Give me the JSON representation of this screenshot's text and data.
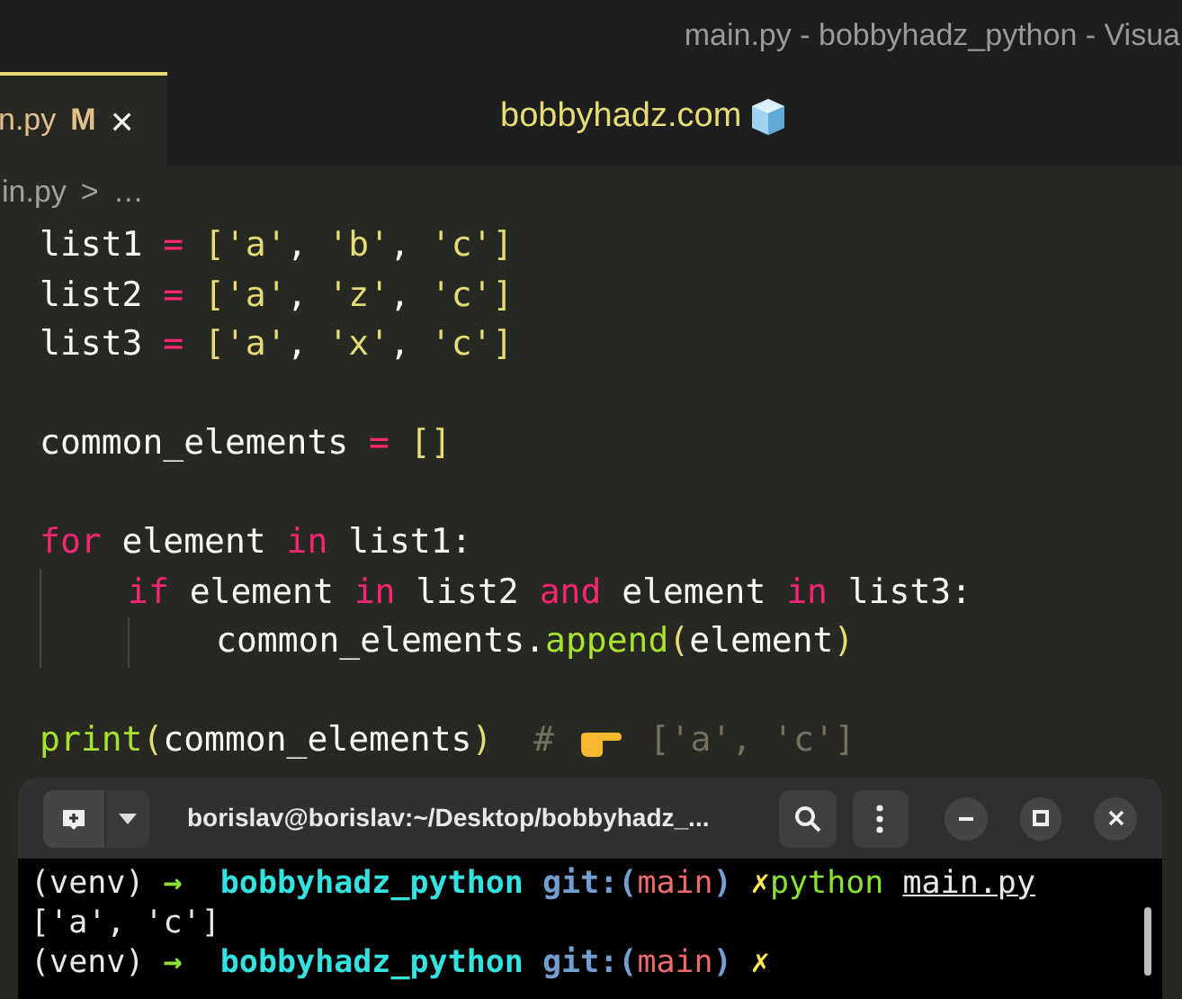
{
  "window": {
    "title": "main.py - bobbyhadz_python - Visua"
  },
  "tab": {
    "label": "n.py",
    "badge": "M",
    "close": "×",
    "selected": true
  },
  "banner": {
    "text": "bobbyhadz.com"
  },
  "breadcrumb": {
    "file": "in.py",
    "separator": ">",
    "more": "…"
  },
  "code_lines": [
    {
      "kind": "code",
      "tokens": [
        {
          "kind": "text",
          "text": "list1 "
        },
        {
          "kind": "operator",
          "text": "= "
        },
        {
          "kind": "punct",
          "text": "["
        },
        {
          "kind": "string",
          "text": "'a'"
        },
        {
          "kind": "text",
          "text": ", "
        },
        {
          "kind": "string",
          "text": "'b'"
        },
        {
          "kind": "text",
          "text": ", "
        },
        {
          "kind": "string",
          "text": "'c'"
        },
        {
          "kind": "punct",
          "text": "]"
        }
      ]
    },
    {
      "kind": "code",
      "tokens": [
        {
          "kind": "text",
          "text": "list2 "
        },
        {
          "kind": "operator",
          "text": "= "
        },
        {
          "kind": "punct",
          "text": "["
        },
        {
          "kind": "string",
          "text": "'a'"
        },
        {
          "kind": "text",
          "text": ", "
        },
        {
          "kind": "string",
          "text": "'z'"
        },
        {
          "kind": "text",
          "text": ", "
        },
        {
          "kind": "string",
          "text": "'c'"
        },
        {
          "kind": "punct",
          "text": "]"
        }
      ]
    },
    {
      "kind": "code",
      "tokens": [
        {
          "kind": "text",
          "text": "list3 "
        },
        {
          "kind": "operator",
          "text": "= "
        },
        {
          "kind": "punct",
          "text": "["
        },
        {
          "kind": "string",
          "text": "'a'"
        },
        {
          "kind": "text",
          "text": ", "
        },
        {
          "kind": "string",
          "text": "'x'"
        },
        {
          "kind": "text",
          "text": ", "
        },
        {
          "kind": "string",
          "text": "'c'"
        },
        {
          "kind": "punct",
          "text": "]"
        }
      ]
    },
    {
      "kind": "blank"
    },
    {
      "kind": "code",
      "tokens": [
        {
          "kind": "text",
          "text": "common_elements "
        },
        {
          "kind": "operator",
          "text": "= "
        },
        {
          "kind": "punct",
          "text": "[]"
        }
      ]
    },
    {
      "kind": "blank"
    },
    {
      "kind": "code",
      "tokens": [
        {
          "kind": "keyword",
          "text": "for"
        },
        {
          "kind": "text",
          "text": " element "
        },
        {
          "kind": "keyword",
          "text": "in"
        },
        {
          "kind": "text",
          "text": " list1:"
        }
      ],
      "children": [
        {
          "kind": "code",
          "tokens": [
            {
              "kind": "keyword",
              "text": "if"
            },
            {
              "kind": "text",
              "text": " element "
            },
            {
              "kind": "keyword",
              "text": "in"
            },
            {
              "kind": "text",
              "text": " list2 "
            },
            {
              "kind": "keyword",
              "text": "and"
            },
            {
              "kind": "text",
              "text": " element "
            },
            {
              "kind": "keyword",
              "text": "in"
            },
            {
              "kind": "text",
              "text": " list3:"
            }
          ],
          "children": [
            {
              "kind": "code",
              "tokens": [
                {
                  "kind": "text",
                  "text": "common_elements."
                },
                {
                  "kind": "call",
                  "text": "append"
                },
                {
                  "kind": "punct",
                  "text": "("
                },
                {
                  "kind": "text",
                  "text": "element"
                },
                {
                  "kind": "punct",
                  "text": ")"
                }
              ]
            }
          ]
        }
      ]
    },
    {
      "kind": "blank"
    },
    {
      "kind": "code",
      "tokens": [
        {
          "kind": "call",
          "text": "print"
        },
        {
          "kind": "punct",
          "text": "("
        },
        {
          "kind": "text",
          "text": "common_elements"
        },
        {
          "kind": "punct",
          "text": ")"
        },
        {
          "kind": "comment",
          "text": "  # "
        },
        {
          "kind": "icon"
        },
        {
          "kind": "comment",
          "text": " ['a', 'c']"
        }
      ]
    }
  ],
  "terminal": {
    "title": "borislav@borislav:~/Desktop/bobbyhadz_...",
    "lines": [
      {
        "tokens": [
          {
            "kind": "plain",
            "text": "(venv) "
          },
          {
            "kind": "arrow",
            "text": "→"
          },
          {
            "kind": "dir",
            "text": "  bobbyhadz_python "
          },
          {
            "kind": "git",
            "text": "git:("
          },
          {
            "kind": "branch",
            "text": "main"
          },
          {
            "kind": "git",
            "text": ")"
          },
          {
            "kind": "dirty",
            "text": " ✗"
          },
          {
            "kind": "command",
            "text": "python "
          },
          {
            "kind": "arg",
            "text": "main.py"
          }
        ]
      },
      {
        "tokens": [
          {
            "kind": "plain",
            "text": "['a', 'c']"
          }
        ]
      },
      {
        "tokens": [
          {
            "kind": "plain",
            "text": "(venv) "
          },
          {
            "kind": "arrow",
            "text": "→"
          },
          {
            "kind": "dir",
            "text": "  bobbyhadz_python "
          },
          {
            "kind": "git",
            "text": "git:("
          },
          {
            "kind": "branch",
            "text": "main"
          },
          {
            "kind": "git",
            "text": ")"
          },
          {
            "kind": "dirty",
            "text": " ✗"
          }
        ]
      }
    ]
  }
}
